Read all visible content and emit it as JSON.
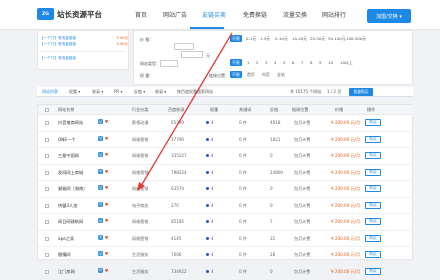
{
  "header": {
    "logo_mark": "ZG",
    "logo_text": "站长资源平台",
    "nav": [
      "首页",
      "网站广告",
      "友链买卖",
      "免费换链",
      "流量交换",
      "网站排行"
    ],
    "cta": "加盟/交换 ▾"
  },
  "promo": {
    "rows": [
      {
        "text": "【一个门】有流量链接",
        "price": "3.00元"
      },
      {
        "text": "【一个门】有流量链接",
        "price": "3.00元"
      },
      {
        "text": "【一个门】有流量链接",
        "price": ""
      }
    ]
  },
  "filter": {
    "price_label": "价 格：",
    "price_options": [
      "不限",
      "0-1元",
      "1-5元",
      "5-10元",
      "10-20元",
      "20-50元",
      "50-100元",
      "100-500元"
    ],
    "range_unit": "元",
    "type_label": "网站类型：",
    "weight_label": "权 重：",
    "weight_options": [
      "不限",
      "1",
      "2",
      "3",
      "4",
      "5",
      "6",
      "7",
      "8",
      "9",
      "10",
      "10以上"
    ],
    "link_label": "链接位置：",
    "link_options": [
      "不限",
      "首页",
      "内页",
      "全站"
    ]
  },
  "tabs": {
    "items": [
      "网站列表",
      "权重 ▾",
      "收录 ▾",
      "PR ▾",
      "反链 ▾",
      "收录 ▾",
      "按百度权重搜索网站"
    ],
    "query_button": "批量购买",
    "pager_text": "共 10175 个网站",
    "page_info": "1 / 2 页"
  },
  "table": {
    "headers": [
      "网站名称",
      "行业分类",
      "百度收录",
      "权重",
      "关键词",
      "反链",
      "链接位置",
      "价格",
      "操作"
    ],
    "rows": [
      {
        "name": "抖音电商网站",
        "category": "影视动漫",
        "baidu": "55349",
        "weight": "4",
        "keywords": "0 件",
        "backlinks": "4918",
        "position": "包月计费",
        "price": "¥ 200.00 元/月",
        "action": "购买"
      },
      {
        "name": "ONE一个",
        "category": "网络营销",
        "baidu": "17790",
        "weight": "4",
        "keywords": "0 件",
        "backlinks": "1821",
        "position": "包月计费",
        "price": "¥ 200.00 元/月",
        "action": "购买"
      },
      {
        "name": "三星中国网",
        "category": "网络营销",
        "baidu": "335227",
        "weight": "4",
        "keywords": "0 件",
        "backlinks": "0",
        "position": "包月计费",
        "price": "¥ 200.00 元/月",
        "action": "购买"
      },
      {
        "name": "发网网上商城",
        "category": "网络营销",
        "baidu": "798224",
        "weight": "4",
        "keywords": "0 件",
        "backlinks": "14800",
        "position": "包月计费",
        "price": "¥ 240.00 元/月",
        "action": "购买"
      },
      {
        "name": "湘雅网（湖南）",
        "category": "网络营销",
        "baidu": "63574",
        "weight": "4",
        "keywords": "0 件",
        "backlinks": "0",
        "position": "包月计费",
        "price": "¥ 200.00 元/月",
        "action": "购买"
      },
      {
        "name": "快盟3人加",
        "category": "电子商务",
        "baidu": "370",
        "weight": "4",
        "keywords": "0 件",
        "backlinks": "0",
        "position": "包月计费",
        "price": "¥ 200.00 元/月",
        "action": "购买"
      },
      {
        "name": "网日网建筑网",
        "category": "网络营销",
        "baidu": "85185",
        "weight": "4",
        "keywords": "0 件",
        "backlinks": "7",
        "position": "包月计费",
        "price": "¥ 200.00 元/月",
        "action": "购买"
      },
      {
        "name": "ape之家",
        "category": "网络营销",
        "baidu": "4145",
        "weight": "4",
        "keywords": "0 件",
        "backlinks": "31",
        "position": "包月计费",
        "price": "¥ 200.00 元/月",
        "action": "购买"
      },
      {
        "name": "傲慢网",
        "category": "生活服务",
        "baidu": "7006",
        "weight": "4",
        "keywords": "0 件",
        "backlinks": "28",
        "position": "包月计费",
        "price": "¥ 200.00 元/月",
        "action": "购买"
      },
      {
        "name": "江门房网",
        "category": "生活服务",
        "baidu": "734922",
        "weight": "4",
        "keywords": "0 件",
        "backlinks": "0",
        "position": "包月计费",
        "price": "¥ 200.00 元/月",
        "action": "购买"
      }
    ]
  },
  "colors": {
    "accent": "#1e88e5",
    "price_orange": "#e8590c",
    "arrow_red": "#e53935"
  }
}
